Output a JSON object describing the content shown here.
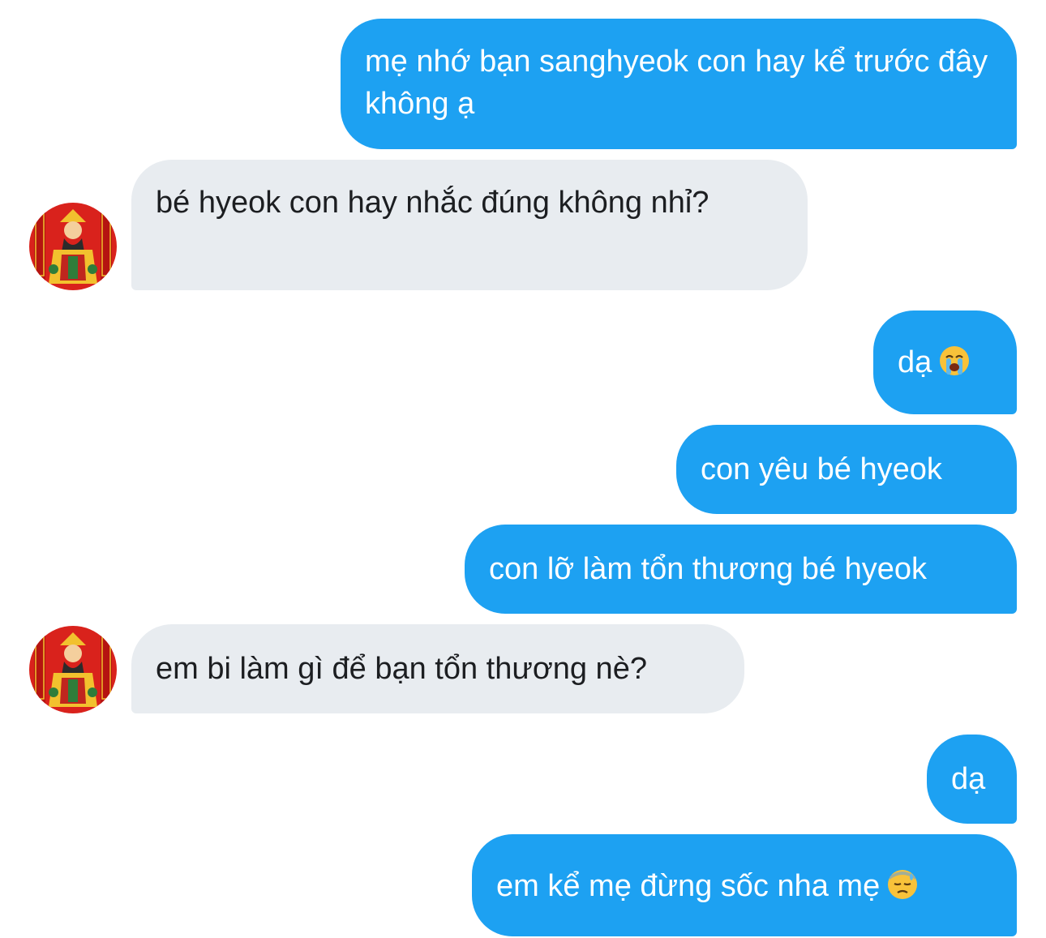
{
  "messages": [
    {
      "side": "sent",
      "text": "mẹ nhớ bạn sanghyeok con hay kể trước đây không ạ"
    },
    {
      "side": "received",
      "text": "bé hyeok con hay nhắc đúng không nhỉ?"
    },
    {
      "side": "sent",
      "text": "dạ",
      "emoji": "loudly-crying-face-emoji"
    },
    {
      "side": "sent",
      "text": "con yêu bé hyeok"
    },
    {
      "side": "sent",
      "text": "con lỡ làm tổn thương bé hyeok"
    },
    {
      "side": "received",
      "text": "em bi làm gì để bạn tổn thương nè?"
    },
    {
      "side": "sent",
      "text": "dạ"
    },
    {
      "side": "sent",
      "text": "em kể mẹ đừng sốc nha mẹ",
      "emoji": "downcast-face-with-sweat-emoji"
    }
  ],
  "colors": {
    "sent_bubble": "#1da1f2",
    "received_bubble": "#e8ecf0",
    "avatar_background": "#d9221c",
    "avatar_gold": "#f2c12e"
  }
}
